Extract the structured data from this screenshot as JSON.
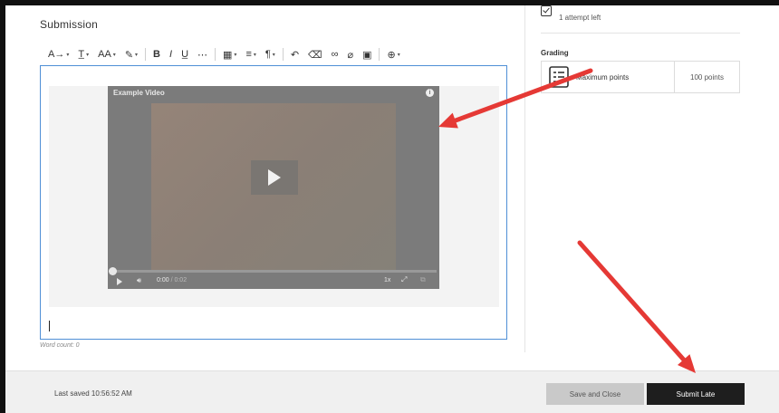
{
  "submission": {
    "title": "Submission",
    "word_count": "Word count: 0"
  },
  "toolbar": {
    "items": [
      {
        "icon": "paragraph-style-icon",
        "glyph": "A→",
        "has_caret": true
      },
      {
        "icon": "text-format-icon",
        "glyph": "T̲",
        "has_caret": true
      },
      {
        "icon": "font-size-icon",
        "glyph": "AΑ",
        "has_caret": true
      },
      {
        "icon": "text-color-icon",
        "glyph": "✎",
        "has_caret": true
      },
      {
        "icon": "bold-icon",
        "glyph": "B",
        "has_caret": false
      },
      {
        "icon": "italic-icon",
        "glyph": "I",
        "has_caret": false
      },
      {
        "icon": "underline-icon",
        "glyph": "U̲",
        "has_caret": false
      },
      {
        "icon": "more-icon",
        "glyph": "⋯",
        "has_caret": false
      },
      {
        "icon": "table-icon",
        "glyph": "▦",
        "has_caret": true
      },
      {
        "icon": "align-icon",
        "glyph": "≡",
        "has_caret": true
      },
      {
        "icon": "paragraph-icon",
        "glyph": "¶",
        "has_caret": true
      },
      {
        "icon": "undo-icon",
        "glyph": "↶",
        "has_caret": false
      },
      {
        "icon": "eraser-icon",
        "glyph": "⌫",
        "has_caret": false
      },
      {
        "icon": "link-icon",
        "glyph": "∞",
        "has_caret": false
      },
      {
        "icon": "attach-icon",
        "glyph": "⌀",
        "has_caret": false
      },
      {
        "icon": "image-icon",
        "glyph": "▣",
        "has_caret": false
      },
      {
        "icon": "insert-icon",
        "glyph": "⊕",
        "has_caret": true
      }
    ]
  },
  "video": {
    "title": "Example Video",
    "time_current": "0:00",
    "time_duration": "/ 0:02",
    "speed": "1x",
    "progress": 0
  },
  "sidebar": {
    "attempts_left": "1 attempt left",
    "grading_title": "Grading",
    "max_points_label": "Maximum points",
    "points_value": "100 points"
  },
  "footer": {
    "last_saved": "Last saved 10:56:52 AM",
    "save_close_label": "Save and Close",
    "submit_label": "Submit Late"
  },
  "colors": {
    "annotation_arrow": "#e53935",
    "editor_border": "#4f8fd6",
    "submit_button": "#1e1e1e"
  }
}
